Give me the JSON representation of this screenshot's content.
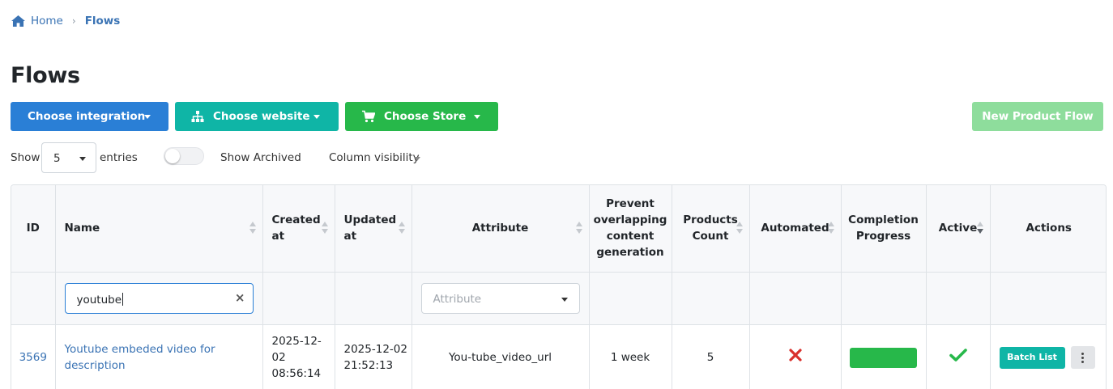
{
  "breadcrumb": {
    "home": "Home",
    "separator": "›",
    "current": "Flows"
  },
  "page_title": "Flows",
  "toolbar": {
    "integration_label": "Choose integration",
    "website_label": "Choose website",
    "store_label": "Choose Store",
    "new_flow_label": "New Product Flow"
  },
  "controls": {
    "show_label": "Show",
    "entries_value": "5",
    "entries_label": "entries",
    "show_archived_label": "Show Archived",
    "show_archived_on": false,
    "column_visibility_label": "Column visibility"
  },
  "table": {
    "columns": {
      "id": "ID",
      "name": "Name",
      "created_at_1": "Created",
      "created_at_2": "at",
      "updated_at_1": "Updated",
      "updated_at_2": "at",
      "attribute": "Attribute",
      "prevent_1": "Prevent",
      "prevent_2": "overlapping",
      "prevent_3": "content",
      "prevent_4": "generation",
      "products_1": "Products",
      "products_2": "Count",
      "automated": "Automated",
      "completion_1": "Completion",
      "completion_2": "Progress",
      "active": "Active",
      "actions": "Actions"
    },
    "filters": {
      "name_value": "youtube",
      "clear_icon": "×",
      "attribute_placeholder": "Attribute"
    },
    "rows": [
      {
        "id": "3569",
        "name": "Youtube embeded video for description",
        "created_date": "2025-12-",
        "created_date2": "02",
        "created_time": "08:56:14",
        "updated_date": "2025-12-02",
        "updated_time": "21:52:13",
        "attribute": "You-tube_video_url",
        "prevent": "1 week",
        "products_count": "5",
        "automated": false,
        "completion_progress": 1.0,
        "active": true,
        "batch_label": "Batch List"
      }
    ]
  },
  "colors": {
    "link": "#3a73b4",
    "integration": "#2a7fd6",
    "website": "#0fb5a6",
    "store": "#27b84a",
    "new_flow": "#8edd9c",
    "danger": "#d9302c",
    "success": "#27b84a"
  },
  "icons": {
    "home": "home-icon",
    "website": "sitemap-icon",
    "store": "cart-icon",
    "automated_false": "x-icon",
    "active_true": "check-icon",
    "more": "kebab-icon"
  }
}
